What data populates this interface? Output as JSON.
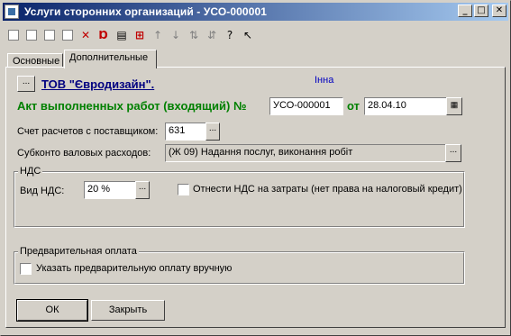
{
  "window": {
    "title": "Услуги сторонних организаций - УСО-000001"
  },
  "titlebar_buttons": {
    "minimize": "_",
    "maximize": "□",
    "close": "✕"
  },
  "tabs": [
    {
      "label": "Основные"
    },
    {
      "label": "Дополнительные"
    }
  ],
  "header": {
    "org_button": "...",
    "org_name": "ТОВ \"Євродизайн\".",
    "org_hint": "Інна"
  },
  "doc": {
    "title": "Акт выполненных работ (входящий) №",
    "number": "УСО-000001",
    "date_label": "от",
    "date": "28.04.10"
  },
  "fields": {
    "account_label": "Счет расчетов с поставщиком:",
    "account_value": "631",
    "subconto_label": "Субконто валовых расходов:",
    "subconto_value": "(Ж 09) Надання послуг, виконання робіт"
  },
  "vat": {
    "group_title": "НДС",
    "type_label": "Вид НДС:",
    "type_value": "20 %",
    "expense_label": "Отнести НДС на затраты (нет права на налоговый кредит)"
  },
  "prepay": {
    "group_title": "Предварительная оплата",
    "manual_label": "Указать предварительную оплату вручную"
  },
  "buttons": {
    "ok": "ОК",
    "close": "Закрыть"
  }
}
